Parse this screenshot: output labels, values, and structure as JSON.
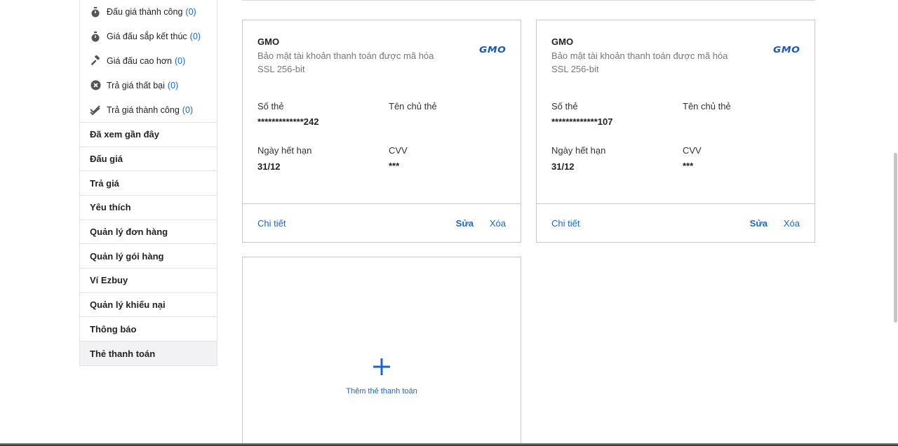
{
  "sidebar": {
    "sub_items": [
      {
        "label": "Đấu giá thành công",
        "count": "(0)",
        "icon": "stopwatch-icon"
      },
      {
        "label": "Giá đấu sắp kết thúc",
        "count": "(0)",
        "icon": "stopwatch-icon"
      },
      {
        "label": "Giá đấu cao hơn",
        "count": "(0)",
        "icon": "gavel-icon"
      },
      {
        "label": "Trả giá thất bại",
        "count": "(0)",
        "icon": "x-circle-icon"
      },
      {
        "label": "Trả giá thành công",
        "count": "(0)",
        "icon": "double-check-icon"
      }
    ],
    "menu": [
      "Đã xem gần đây",
      "Đấu giá",
      "Trả giá",
      "Yêu thích",
      "Quản lý đơn hàng",
      "Quản lý gói hàng",
      "Ví Ezbuy",
      "Quản lý khiếu nại",
      "Thông báo",
      "Thẻ thanh toán"
    ],
    "active_index": 9
  },
  "cards": [
    {
      "name": "GMO",
      "desc_line1": "Bảo mật tài khoản thanh toán được mã hóa",
      "desc_line2": "SSL 256-bit",
      "logo": "GMO",
      "card_number_label": "Số thẻ",
      "card_number": "*************242",
      "holder_label": "Tên chủ thẻ",
      "holder": "",
      "expiry_label": "Ngày hết hạn",
      "expiry": "31/12",
      "cvv_label": "CVV",
      "cvv": "***",
      "detail": "Chi tiết",
      "edit": "Sửa",
      "delete": "Xóa"
    },
    {
      "name": "GMO",
      "desc_line1": "Bảo mật tài khoản thanh toán được mã hóa",
      "desc_line2": "SSL 256-bit",
      "logo": "GMO",
      "card_number_label": "Số thẻ",
      "card_number": "*************107",
      "holder_label": "Tên chủ thẻ",
      "holder": "",
      "expiry_label": "Ngày hết hạn",
      "expiry": "31/12",
      "cvv_label": "CVV",
      "cvv": "***",
      "detail": "Chi tiết",
      "edit": "Sửa",
      "delete": "Xóa"
    }
  ],
  "add_card": {
    "label": "Thêm thẻ thanh toán",
    "icon": "plus-icon"
  },
  "colors": {
    "accent": "#1a66c9",
    "logo": "#1b57b8",
    "active_bg": "#f2f2f4"
  }
}
